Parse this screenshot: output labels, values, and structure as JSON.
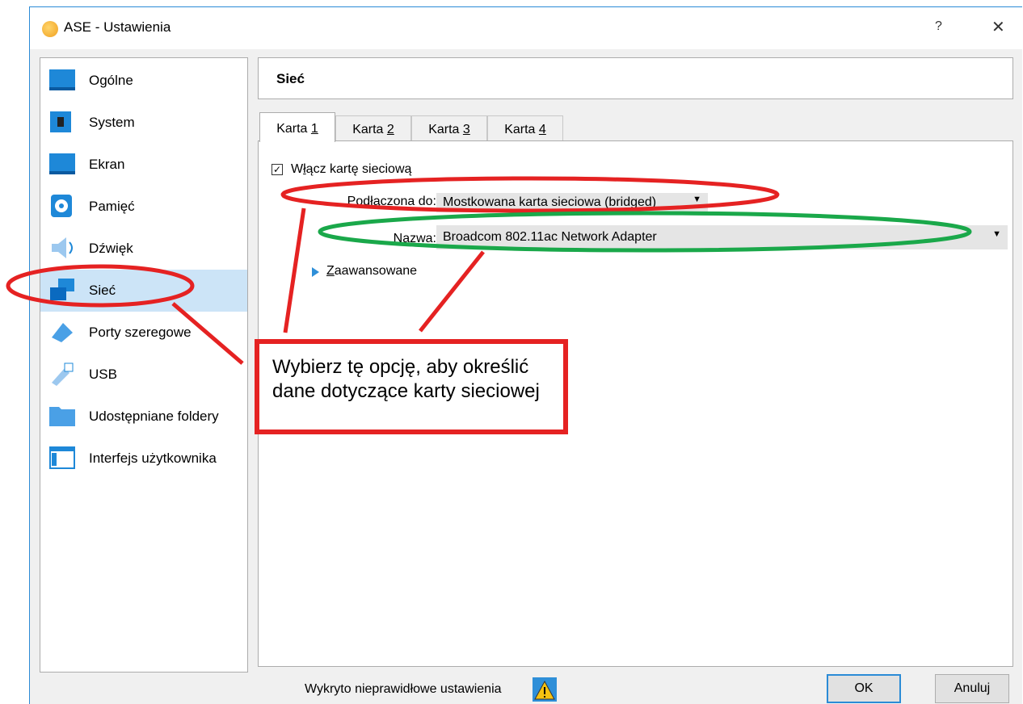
{
  "window": {
    "title": "ASE - Ustawienia",
    "help": "?",
    "close": "✕"
  },
  "sidebar": {
    "items": [
      {
        "label": "Ogólne",
        "icon": "general-icon"
      },
      {
        "label": "System",
        "icon": "chip-icon"
      },
      {
        "label": "Ekran",
        "icon": "display-icon"
      },
      {
        "label": "Pamięć",
        "icon": "disk-icon"
      },
      {
        "label": "Dźwięk",
        "icon": "speaker-icon"
      },
      {
        "label": "Sieć",
        "icon": "network-icon",
        "selected": true
      },
      {
        "label": "Porty szeregowe",
        "icon": "serial-port-icon"
      },
      {
        "label": "USB",
        "icon": "usb-icon"
      },
      {
        "label": "Udostępniane foldery",
        "icon": "folder-icon"
      },
      {
        "label": "Interfejs użytkownika",
        "icon": "ui-icon"
      }
    ]
  },
  "header": {
    "title": "Sieć"
  },
  "tabs": [
    {
      "prefix": "Karta ",
      "key": "1",
      "active": true
    },
    {
      "prefix": "Karta ",
      "key": "2"
    },
    {
      "prefix": "Karta ",
      "key": "3"
    },
    {
      "prefix": "Karta ",
      "key": "4"
    }
  ],
  "adapter": {
    "enable_prefix": "W",
    "enable_key": "ł",
    "enable_rest": "ącz kartę sieciową",
    "enabled": true,
    "attached_prefix": "Podł",
    "attached_key": "ą",
    "attached_rest": "czona do:",
    "attached_value": "Mostkowana karta sieciowa (bridged)",
    "name_key": "N",
    "name_rest": "azwa:",
    "name_value": "Broadcom 802.11ac Network Adapter",
    "advanced_key": "Z",
    "advanced_rest": "aawansowane"
  },
  "status": {
    "text": "Wykryto nieprawidłowe ustawienia"
  },
  "buttons": {
    "ok": "OK",
    "cancel": "Anuluj"
  },
  "callout": {
    "text": "Wybierz tę opcję, aby określić dane dotyczące karty sieciowej"
  },
  "colors": {
    "red_annotation": "#e52222",
    "green_annotation": "#1aa84a",
    "accent": "#2b8bd6",
    "selection": "#cce4f7"
  }
}
